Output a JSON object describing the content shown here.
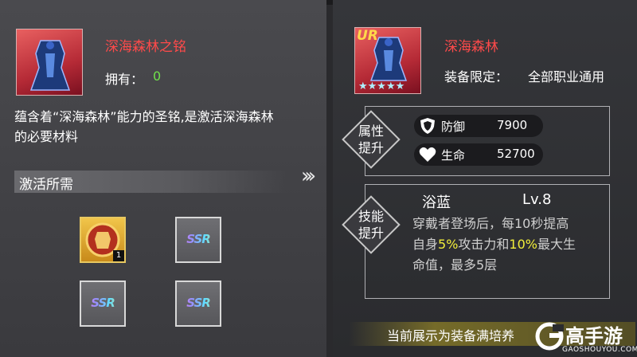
{
  "left": {
    "item_name": "深海森林之铭",
    "own_label": "拥有：",
    "own_count": "0",
    "description": "蕴含着“深海森林”能力的圣铭,是激活深海森林的必要材料",
    "section_title": "激活所需",
    "materials": [
      {
        "type": "emblem",
        "count": "1"
      },
      {
        "type": "ssr",
        "label": "SSR"
      },
      {
        "type": "ssr",
        "label": "SSR"
      },
      {
        "type": "ssr",
        "label": "SSR"
      }
    ]
  },
  "arrows": "›››",
  "right": {
    "rarity": "UR",
    "equip_name": "深海森林",
    "limit_label": "装备限定：",
    "limit_value": "全部职业通用",
    "stars": 5,
    "attr_label_1": "属性",
    "attr_label_2": "提升",
    "stats": [
      {
        "icon": "shield-icon",
        "name": "防御",
        "value": "7900"
      },
      {
        "icon": "heart-icon",
        "name": "生命",
        "value": "52700"
      }
    ],
    "skill_label_1": "技能",
    "skill_label_2": "提升",
    "skill_name": "浴蓝",
    "skill_level": "Lv.8",
    "skill_desc_1": "穿戴者登场后，每10秒提高",
    "skill_desc_2a": "自身",
    "skill_desc_2b": "5%",
    "skill_desc_2c": "攻击力和",
    "skill_desc_2d": "10%",
    "skill_desc_2e": "最大生",
    "skill_desc_3": "命值，最多5层",
    "footer_note": "当前展示为装备满培养"
  },
  "watermark": {
    "brand": "高手游",
    "url": "GAOSHOUYOU.COM"
  },
  "colors": {
    "name_red": "#ff4a4a",
    "green": "#6fe04a",
    "highlight_yellow": "#f2ee3a"
  }
}
